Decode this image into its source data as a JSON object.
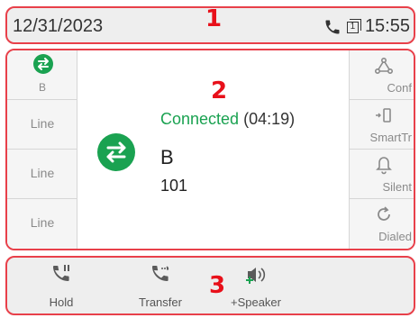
{
  "status_bar": {
    "date": "12/31/2023",
    "time": "15:55",
    "line_badge": "1",
    "icons": [
      "phone-icon",
      "line-badge-icon"
    ]
  },
  "annotations": [
    "1",
    "2",
    "3"
  ],
  "line_keys": [
    {
      "label": "B",
      "icon": "transfer-arrows-icon",
      "active": true
    },
    {
      "label": "Line"
    },
    {
      "label": "Line"
    },
    {
      "label": "Line"
    }
  ],
  "right_keys": [
    {
      "label": "Conf",
      "icon": "conference-icon"
    },
    {
      "label": "SmartTr",
      "icon": "smart-transfer-icon"
    },
    {
      "label": "Silent",
      "icon": "bell-icon"
    },
    {
      "label": "Dialed",
      "icon": "redial-icon"
    }
  ],
  "call": {
    "status": "Connected",
    "duration": "(04:19)",
    "name": "B",
    "number": "101"
  },
  "softkeys": [
    {
      "label": "Hold",
      "icon": "hold-icon"
    },
    {
      "label": "Transfer",
      "icon": "transfer-icon"
    },
    {
      "label": "+Speaker",
      "icon": "speaker-icon"
    }
  ],
  "colors": {
    "accent_green": "#1aa251",
    "annotation_red": "#e8101a",
    "icon_gray": "#8a8a8a"
  }
}
